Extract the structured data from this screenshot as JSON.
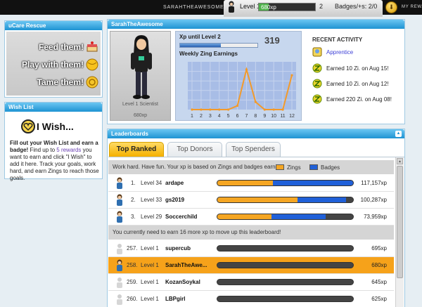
{
  "topbar": {
    "username": "SarahTheAwesome",
    "level_label": "Level 1",
    "xp_label": "680xp",
    "xp_progress": 0.18,
    "next_level": "2",
    "badges_label": "Badges/+s: 2/0",
    "rewards_label": "My Rewards"
  },
  "rescue": {
    "title": "uCare Rescue",
    "items": [
      "Feed them!",
      "Play with them!",
      "Tame them!"
    ]
  },
  "wishlist": {
    "title": "Wish List",
    "heading": "I Wish...",
    "text_bold": "Fill out your Wish List and earn a badge!",
    "text_1": " Find up to ",
    "text_link": "5 rewards",
    "text_2": " you want to earn and click \"I Wish\" to add it here. Track your goals, work hard, and earn Zings to reach those goals."
  },
  "profile": {
    "title": "SarahTheAwesome",
    "caption": "Level 1 Scientist",
    "xp": "680xp"
  },
  "xp_box": {
    "title": "Xp until Level 2",
    "remaining": "319",
    "progress": 0.53,
    "earnings_title": "Weekly Zing Earnings"
  },
  "chart_data": {
    "type": "line",
    "title": "Weekly Zing Earnings",
    "x": [
      1,
      2,
      3,
      4,
      5,
      6,
      7,
      8,
      9,
      10,
      11,
      12
    ],
    "values": [
      0,
      0,
      0,
      0,
      0,
      20,
      210,
      40,
      0,
      0,
      0,
      180
    ],
    "ylim": [
      0,
      250
    ],
    "grid": true,
    "line_color": "#f39a2a",
    "bg_color": "#a8bde6"
  },
  "activity": {
    "title": "RECENT ACTIVITY",
    "items": [
      {
        "text": "Apprentice",
        "link": true,
        "icon": "badge-icon"
      },
      {
        "text": "Earned 10 Zi. on Aug 15!",
        "link": false,
        "icon": "zing-icon"
      },
      {
        "text": "Earned 10 Zi. on Aug 12!",
        "link": false,
        "icon": "zing-icon"
      },
      {
        "text": "Earned 220 Zi. on Aug 08!",
        "link": false,
        "icon": "zing-icon"
      }
    ]
  },
  "leaderboard": {
    "title": "Leaderboards",
    "tabs": [
      "Top Ranked",
      "Top Donors",
      "Top Spenders"
    ],
    "active_tab": 0,
    "note": "Work hard. Have fun. Your xp is based on Zings and badges earned.",
    "legend_zings": "Zings",
    "legend_badges": "Badges",
    "zings_color": "#f5a623",
    "badges_color": "#2060d8",
    "top_rows": [
      {
        "rank": "1.",
        "level": "Level 34",
        "name": "ardape",
        "zings": 0.41,
        "badges": 0.59,
        "xp": "117,157xp"
      },
      {
        "rank": "2.",
        "level": "Level 33",
        "name": "gs2019",
        "zings": 0.59,
        "badges": 0.36,
        "xp": "100,287xp"
      },
      {
        "rank": "3.",
        "level": "Level 29",
        "name": "Soccerchild",
        "zings": 0.4,
        "badges": 0.4,
        "xp": "73,959xp"
      }
    ],
    "move_note": "You currently need to earn 16 more xp to move up this leaderboard!",
    "near_rows": [
      {
        "rank": "257.",
        "level": "Level 1",
        "name": "supercub",
        "zings": 0.0,
        "badges": 0.0,
        "xp": "695xp"
      },
      {
        "rank": "258.",
        "level": "Level 1",
        "name": "SarahTheAwe...",
        "zings": 0.0,
        "badges": 0.0,
        "xp": "680xp",
        "highlight": true
      },
      {
        "rank": "259.",
        "level": "Level 1",
        "name": "KozanSoykal",
        "zings": 0.0,
        "badges": 0.0,
        "xp": "645xp"
      },
      {
        "rank": "260.",
        "level": "Level 1",
        "name": "LBPgirl",
        "zings": 0.0,
        "badges": 0.0,
        "xp": "625xp"
      }
    ]
  }
}
